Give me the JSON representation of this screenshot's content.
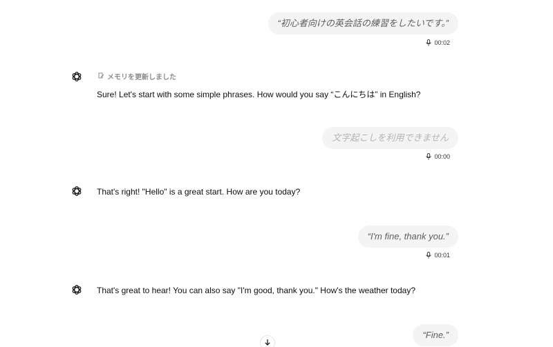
{
  "messages": [
    {
      "role": "user",
      "text": "“初心者向けの英会話の練習をしたいです。”",
      "duration": "00:02"
    },
    {
      "role": "assistant",
      "memory_label": "メモリを更新しました",
      "text": "Sure! Let's start with some simple phrases. How would you say “こんにちは” in English?"
    },
    {
      "role": "user",
      "text": "文字起こしを利用できません",
      "duration": "00:00"
    },
    {
      "role": "assistant",
      "text": "That's right! \"Hello\" is a great start. How are you today?"
    },
    {
      "role": "user",
      "text": "“I'm fine, thank you.”",
      "duration": "00:01"
    },
    {
      "role": "assistant",
      "text": "That's great to hear! You can also say \"I'm good, thank you.\" How's the weather today?"
    },
    {
      "role": "user",
      "text": "“Fine.”"
    }
  ],
  "icons": {
    "assistant_avatar": "openai-logo-icon",
    "duration": "microphone-icon",
    "memory": "memory-edit-icon",
    "scroll": "arrow-down-icon"
  }
}
